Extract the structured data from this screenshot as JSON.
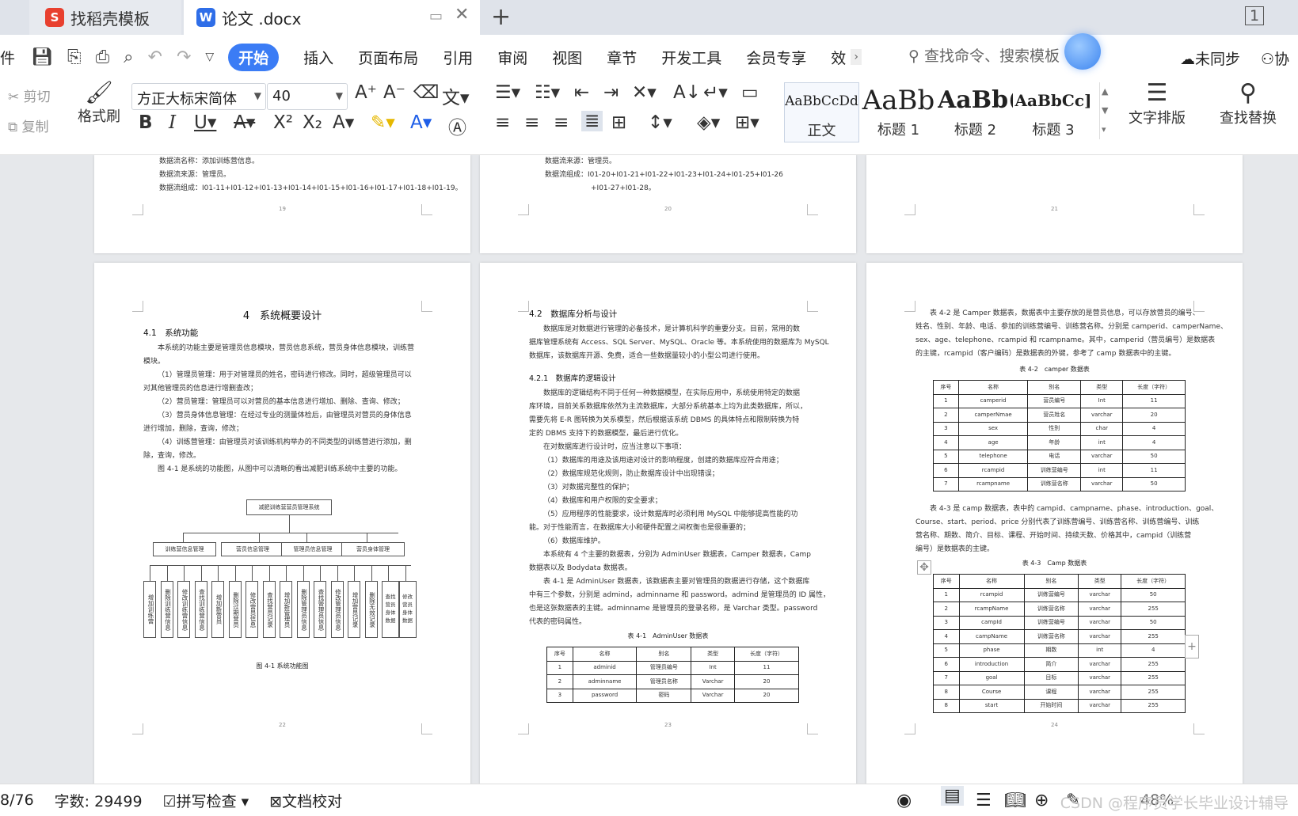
{
  "tabs": [
    {
      "label": "找稻壳模板"
    },
    {
      "label": "论文 .docx"
    }
  ],
  "menu": {
    "file": "件",
    "items": [
      "开始",
      "插入",
      "页面布局",
      "引用",
      "审阅",
      "视图",
      "章节",
      "开发工具",
      "会员专享",
      "效"
    ],
    "search_placeholder": "查找命令、搜索模板",
    "sync": "未同步",
    "collab": "协"
  },
  "ribbon": {
    "cut": "剪切",
    "copy": "复制",
    "format_painter": "格式刷",
    "font": "方正大标宋简体",
    "size": "40",
    "text_layout": "文字排版",
    "find_replace": "查找替换",
    "styles": [
      {
        "sample": "AaBbCcDd",
        "name": "正文"
      },
      {
        "sample": "AaBb",
        "name": "标题 1"
      },
      {
        "sample": "AaBb(",
        "name": "标题 2"
      },
      {
        "sample": "AaBbCc]",
        "name": "标题 3"
      }
    ]
  },
  "pages": {
    "p19": {
      "lines": [
        "数据流名称：添加训练营信息。",
        "数据流来源：管理员。",
        "数据流组成：I01-11+I01-12+I01-13+I01-14+I01-15+I01-16+I01-17+I01-18+I01-19。"
      ],
      "num": "19"
    },
    "p20": {
      "lines": [
        "数据流来源：管理员。",
        "数据流组成：I01-20+I01-21+I01-22+I01-23+I01-24+I01-25+I01-26",
        "+I01-27+I01-28。"
      ],
      "num": "20"
    },
    "p21": {
      "num": "21"
    },
    "p22": {
      "title": "4　系统概要设计",
      "sub": "4.1　系统功能",
      "lines": [
        "本系统的功能主要是管理员信息模块，营员信息系统，营员身体信息模块，训练营",
        "模块。",
        "（1）管理员管理：用于对管理员的姓名，密码进行修改。同时，超级管理员可以",
        "对其他管理员的信息进行增删查改；",
        "（2）营员管理：管理员可以对营员的基本信息进行增加、删除、查询、修改；",
        "（3）营员身体信息管理：在经过专业的测量体检后，由管理员对营员的身体信息",
        "进行增加，删除，查询，修改；",
        "（4）训练营管理：由管理员对该训练机构举办的不同类型的训练营进行添加，删",
        "除，查询，修改。",
        "图 4-1 是系统的功能图，从图中可以清晰的看出减肥训练系统中主要的功能。"
      ],
      "diagram": {
        "root": "减肥训练营营员管理系统",
        "mods": [
          "训练营信息管理",
          "营员信息管理",
          "管理员信息管理",
          "营员身体管理"
        ],
        "leaves": [
          "增加训练营",
          "删除训练营信息",
          "修改训练营信息",
          "查找训练营信息",
          "增加新营员",
          "删除过期营员",
          "修改营员信息",
          "查找营员记录",
          "增加新管理员",
          "删除管理员信息",
          "查找管理员信息",
          "修改管理员信息",
          "增加营员记录",
          "删除无效记录",
          "查找营员身体数据",
          "修改营员身体数据"
        ]
      },
      "caption": "图 4-1 系统功能图",
      "num": "22"
    },
    "p23": {
      "title": "4.2　数据库分析与设计",
      "lines1": [
        "数据库是对数据进行管理的必备技术，是计算机科学的重要分支。目前，常用的数",
        "据库管理系统有 Access、SQL Server、MySQL、Oracle 等。本系统使用的数据库为 MySQL",
        "数据库，该数据库开源、免费，适合一些数据量较小的小型公司进行使用。"
      ],
      "sub": "4.2.1　数据库的逻辑设计",
      "lines2": [
        "数据库的逻辑结构不同于任何一种数据模型，在实际应用中，系统使用特定的数据",
        "库环境，目前关系数据库依然为主流数据库，大部分系统基本上均为此类数据库，所以，",
        "需要先将 E-R 图转换为关系模型，然后根据该系统 DBMS 的具体特点和限制转换为特",
        "定的 DBMS 支持下的数据模型，最后进行优化。",
        "在对数据库进行设计时，应当注意以下事项：",
        "（1）数据库的用途及该用途对设计的影响程度，创建的数据库应符合用途；",
        "（2）数据库规范化规则，防止数据库设计中出现错误；",
        "（3）对数据完整性的保护；",
        "（4）数据库和用户权限的安全要求；",
        "（5）应用程序的性能要求，设计数据库时必须利用 MySQL 中能够提高性能的功",
        "能。对于性能而言，在数据库大小和硬件配置之间权衡也是很重要的；",
        "（6）数据库维护。",
        "本系统有 4 个主要的数据表，分别为 AdminUser 数据表，Camper 数据表，Camp",
        "数据表以及 Bodydata 数据表。",
        "表 4-1 是 AdminUser 数据表，该数据表主要对管理员的数据进行存储，这个数据库",
        "中有三个参数，分别是 admind，adminname 和 password。admind 是管理员的 ID 属性，",
        "也是这张数据表的主键。adminname 是管理员的登录名称，是 Varchar 类型。password",
        "代表的密码属性。"
      ],
      "caption": "表 4-1　AdminUser 数据表",
      "table": {
        "head": [
          "序号",
          "名称",
          "别名",
          "类型",
          "长度（字符）"
        ],
        "rows": [
          [
            "1",
            "adminid",
            "管理员编号",
            "Int",
            "11"
          ],
          [
            "2",
            "adminname",
            "管理员名称",
            "Varchar",
            "20"
          ],
          [
            "3",
            "password",
            "密码",
            "Varchar",
            "20"
          ]
        ]
      },
      "num": "23"
    },
    "p24": {
      "lines1": [
        "表 4-2 是 Camper 数据表，数据表中主要存放的是营员信息，可以存放营员的编号、",
        "姓名、性别、年龄、电话、参加的训练营编号、训练营名称。分别是 camperid、camperName、",
        "sex、age、telephone、rcampid 和 rcampname。其中，camperid（营员编号）是数据表",
        "的主键，rcampid（客户编码）是数据表的外键，参考了 camp 数据表中的主键。"
      ],
      "caption1": "表 4-2　camper 数据表",
      "table1": {
        "head": [
          "序号",
          "名称",
          "别名",
          "类型",
          "长度（字符）"
        ],
        "rows": [
          [
            "1",
            "camperid",
            "营员编号",
            "Int",
            "11"
          ],
          [
            "2",
            "camperNmae",
            "营员姓名",
            "varchar",
            "20"
          ],
          [
            "3",
            "sex",
            "性别",
            "char",
            "4"
          ],
          [
            "4",
            "age",
            "年龄",
            "int",
            "4"
          ],
          [
            "5",
            "telephone",
            "电话",
            "varchar",
            "50"
          ],
          [
            "6",
            "rcampid",
            "训练营编号",
            "int",
            "11"
          ],
          [
            "7",
            "rcampname",
            "训练营名称",
            "varchar",
            "50"
          ]
        ]
      },
      "lines2": [
        "表 4-3 是 camp 数据表，表中的 campid、campname、phase、introduction、goal、",
        "Course、start、period、price 分别代表了训练营编号、训练营名称、训练营编号、训练",
        "营名称、期数、简介、目标、课程、开始时间、持续天数、价格其中，campid（训练营",
        "编号）是数据表的主键。"
      ],
      "caption2": "表 4-3　Camp 数据表",
      "table2": {
        "head": [
          "序号",
          "名称",
          "别名",
          "类型",
          "长度（字符）"
        ],
        "rows": [
          [
            "1",
            "rcampid",
            "训练营编号",
            "varchar",
            "50"
          ],
          [
            "2",
            "rcampName",
            "训练营名称",
            "varchar",
            "255"
          ],
          [
            "3",
            "campId",
            "训练营编号",
            "varchar",
            "50"
          ],
          [
            "4",
            "campName",
            "训练营名称",
            "varchar",
            "255"
          ],
          [
            "5",
            "phase",
            "期数",
            "int",
            "4"
          ],
          [
            "6",
            "introduction",
            "简介",
            "varchar",
            "255"
          ],
          [
            "7",
            "goal",
            "目标",
            "varchar",
            "255"
          ],
          [
            "8",
            "Course",
            "课程",
            "varchar",
            "255"
          ],
          [
            "8",
            "start",
            "开始时间",
            "varchar",
            "255"
          ]
        ]
      },
      "num": "24"
    }
  },
  "status": {
    "page": "8/76",
    "words": "字数: 29499",
    "spell": "拼写检查",
    "proof": "文档校对",
    "zoom": "48%",
    "watermark": "CSDN @程序员学长毕业设计辅导"
  },
  "colors": {
    "accent": "#3b7cf5",
    "tab_icon_red": "#e8402f",
    "tab_icon_blue": "#2f6ee8"
  }
}
